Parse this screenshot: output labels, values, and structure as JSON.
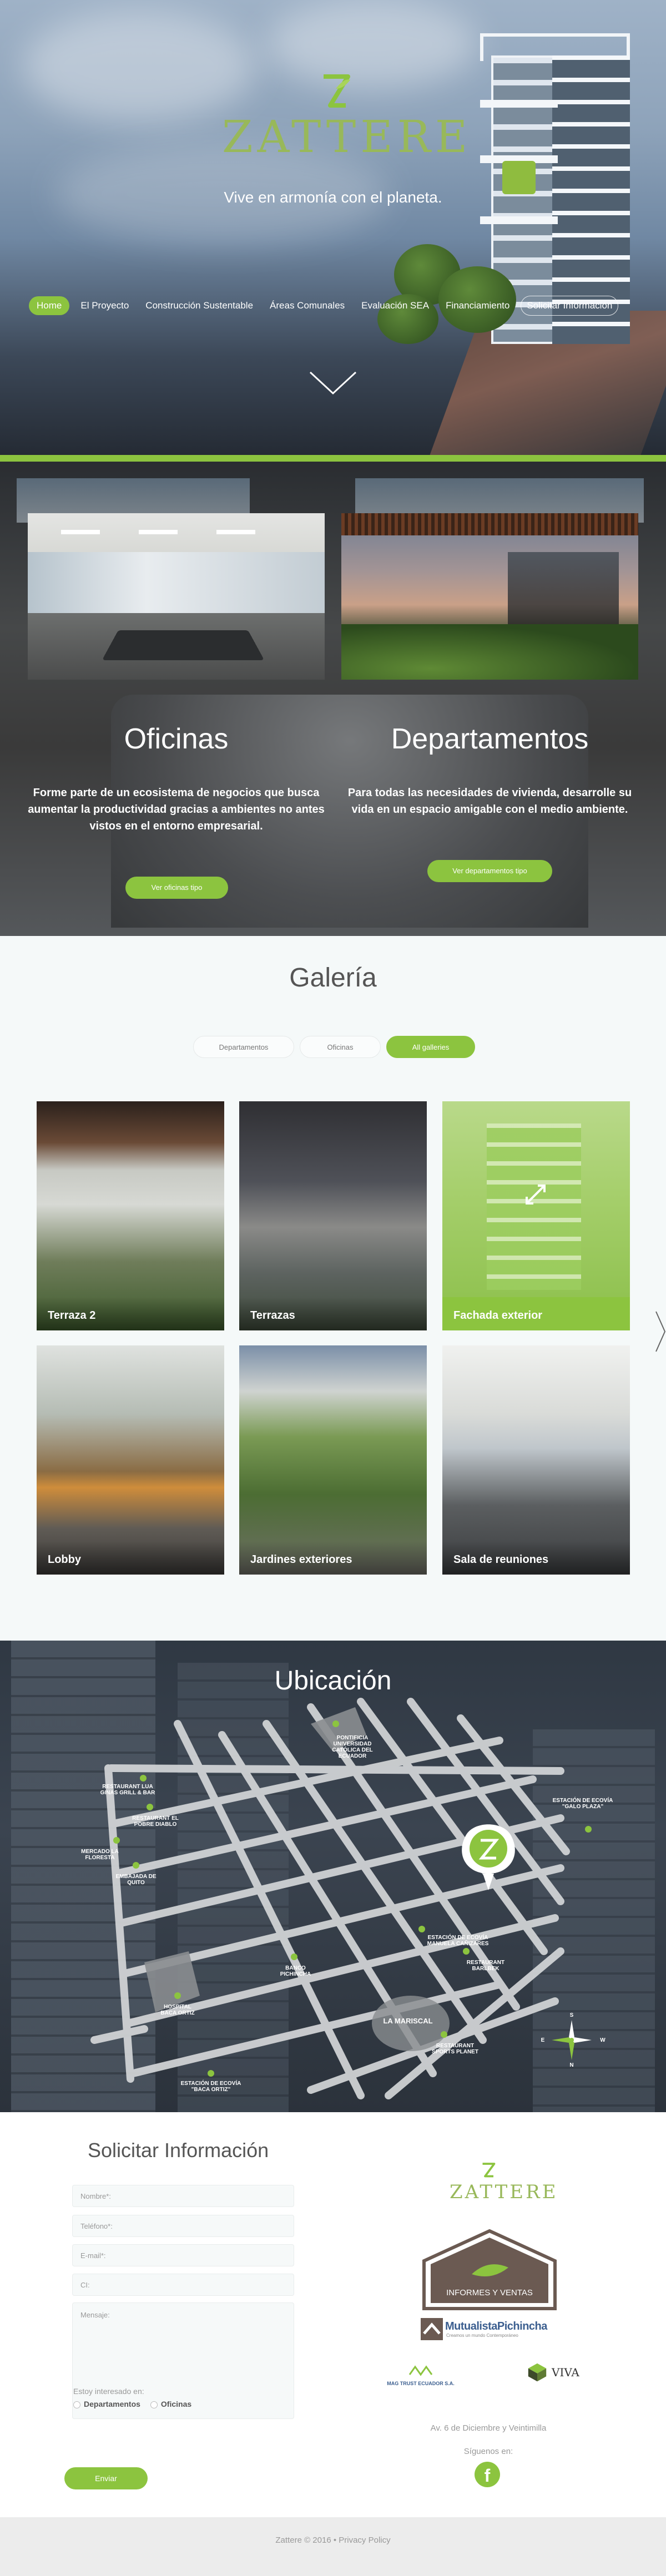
{
  "brand": {
    "name": "ZATTERE",
    "tagline": "Vive en armonía con el planeta."
  },
  "nav": {
    "items": [
      {
        "label": "Home",
        "active": true
      },
      {
        "label": "El Proyecto"
      },
      {
        "label": "Construcción Sustentable"
      },
      {
        "label": "Áreas Comunales"
      },
      {
        "label": "Evaluación SEA"
      },
      {
        "label": "Financiamiento"
      },
      {
        "label": "Solicitar Información",
        "outlined": true
      }
    ],
    "scroll_icon": "chevron-down-icon"
  },
  "units": {
    "offices": {
      "title": "Oficinas",
      "text": "Forme parte de un ecosistema de negocios que busca aumentar la productividad gracias a ambientes no antes vistos en el entorno empresarial.",
      "button": "Ver oficinas tipo"
    },
    "apartments": {
      "title": "Departamentos",
      "text": "Para todas las necesidades de vivienda, desarrolle su vida en un espacio amigable con el medio ambiente.",
      "button": "Ver departamentos tipo"
    }
  },
  "gallery": {
    "title": "Galería",
    "filters": [
      {
        "label": "Departamentos"
      },
      {
        "label": "Oficinas"
      },
      {
        "label": "All galleries",
        "active": true
      }
    ],
    "tiles": [
      {
        "caption": "Terraza 2"
      },
      {
        "caption": "Terrazas"
      },
      {
        "caption": "Fachada exterior",
        "highlighted": true,
        "icon": "expand-icon"
      },
      {
        "caption": "Lobby"
      },
      {
        "caption": "Jardines exteriores"
      },
      {
        "caption": "Sala de reuniones"
      }
    ],
    "next_icon": "chevron-right-icon"
  },
  "location": {
    "title": "Ubicación",
    "labels": [
      "Restaurant Lua Ginas Grill & Bar",
      "Pontificia Universidad Católica del Ecuador",
      "Restaurant El Pobre Diablo",
      "Mercado La Floresta",
      "Embajada de Quito",
      "Estación de Ecovía \"Galo Plaza\"",
      "Banco Pichincha",
      "Estación de Ecovía Manuela Cañizares",
      "Restaurant Barlbek",
      "Hospital Baca Ortiz",
      "La Mariscal",
      "Restaurant Sports Planet",
      "Estación de Ecovía \"Baca Ortiz\""
    ],
    "compass": {
      "n": "N",
      "s": "S",
      "e": "E",
      "w": "W"
    }
  },
  "contact": {
    "title": "Solicitar Información",
    "fields": {
      "name": "Nombre*:",
      "phone": "Teléfono*:",
      "email": "E-mail*:",
      "ci": "CI:",
      "message": "Mensaje:"
    },
    "interest_question": "Estoy interesado en:",
    "options": [
      "Departamentos",
      "Oficinas"
    ],
    "send_button": "Enviar"
  },
  "partners": {
    "sales_sign": "INFORMES Y VENTAS",
    "mutualista": "MutualistaPichincha",
    "mutualista_sub": "Creamos un mundo Contemporáneo",
    "left_partner": "MAG TRUST ECUADOR S.A.",
    "right_partner": "VIVA"
  },
  "address": "Av. 6 de Diciembre y Veintimilla",
  "follow": "Síguenos en:",
  "footer": "Zattere © 2016 • Privacy Policy",
  "colors": {
    "accent": "#8cc43f",
    "logo_green": "#98b85a"
  }
}
